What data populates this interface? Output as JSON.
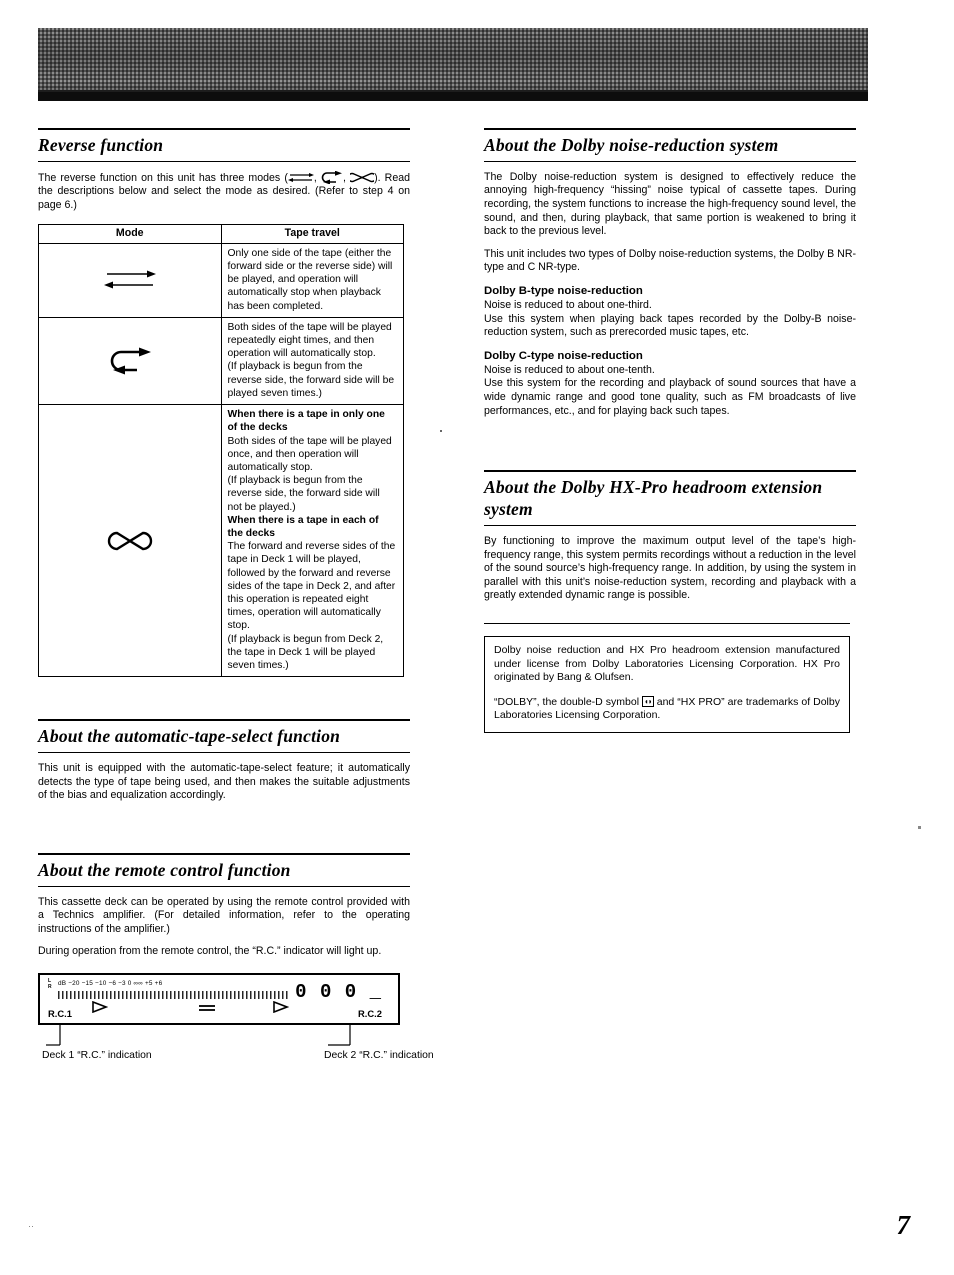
{
  "page": {
    "number": "7",
    "corner_mark": "··"
  },
  "left_column": {
    "reverse": {
      "title": "Reverse function",
      "intro_1": "The reverse function on this unit has three modes (",
      "intro_2": ", ",
      "intro_3": ", ",
      "intro_4": "). Read the descriptions below and select the mode as desired. (Refer to step 4 on page 6.)",
      "table": {
        "headers": [
          "Mode",
          "Tape travel"
        ],
        "rows": [
          {
            "icon": "single-direction-arrows-icon",
            "paragraphs": [
              {
                "bold": false,
                "text": "Only one side of the tape (either the forward side or the reverse side) will be played, and operation will automatically stop when playback has been completed."
              }
            ]
          },
          {
            "icon": "loop-arrow-icon",
            "paragraphs": [
              {
                "bold": false,
                "text": "Both sides of the tape will be played repeatedly eight times, and then operation will automatically stop."
              },
              {
                "bold": false,
                "text": "(If playback is begun from the reverse side, the forward side will be played seven times.)"
              }
            ]
          },
          {
            "icon": "double-loop-arrow-icon",
            "paragraphs": [
              {
                "bold": true,
                "text": "When there is a tape in only one of the decks"
              },
              {
                "bold": false,
                "text": "Both sides of the tape will be played once, and then operation will automatically stop."
              },
              {
                "bold": false,
                "text": "(If playback is begun from the reverse side, the forward side will not be played.)"
              },
              {
                "bold": true,
                "text": "When there is a tape in each of the decks"
              },
              {
                "bold": false,
                "text": "The forward and reverse sides of the tape in Deck 1 will be played, followed by the forward and reverse sides of the tape in Deck 2, and after this operation is repeated eight times, operation will automatically stop."
              },
              {
                "bold": false,
                "text": "(If playback is begun from Deck 2, the tape in Deck 1 will be played seven times.)"
              }
            ]
          }
        ]
      }
    },
    "auto_tape_select": {
      "title": "About the automatic-tape-select function",
      "body": "This unit is equipped with the automatic-tape-select feature; it automatically detects the type of tape being used, and then makes the suitable adjustments of the bias and equalization accordingly."
    },
    "remote_control": {
      "title": "About the remote control function",
      "body_1": "This cassette deck can be operated by using the remote control provided with a Technics amplifier. (For detailed information, refer to the operating instructions of the amplifier.)",
      "body_2": "During operation from the remote control, the “R.C.” indicator will light up.",
      "display": {
        "channel_left": "L",
        "channel_right": "R",
        "scale": "dB  −20    −15    −10     −6     −3      0     ∞∞     +5     +6",
        "digits": "0 0 0 _",
        "label_left": "R.C.1",
        "label_right": "R.C.2",
        "play_icon": "play-triangle-icon",
        "eq_icon": "double-bar-icon"
      },
      "callout_left": "Deck 1 “R.C.” indication",
      "callout_right": "Deck 2 “R.C.” indication"
    }
  },
  "right_column": {
    "dolby_nr": {
      "title": "About the Dolby noise-reduction system",
      "body_1": "The Dolby noise-reduction system is designed to effectively reduce the annoying high-frequency “hissing” noise typical of cassette tapes. During recording, the system functions to increase the high-frequency sound level, the sound, and then, during playback, that same portion is weakened to bring it back to the previous level.",
      "body_2": "This unit includes two types of Dolby noise-reduction systems, the Dolby B NR-type and C NR-type.",
      "sub_b_title": "Dolby B-type noise-reduction",
      "sub_b_body_1": "Noise is reduced to about one-third.",
      "sub_b_body_2": "Use this system when playing back tapes recorded by the Dolby-B noise-reduction system, such as prerecorded music tapes, etc.",
      "sub_c_title": "Dolby C-type noise-reduction",
      "sub_c_body_1": "Noise is reduced to about one-tenth.",
      "sub_c_body_2": "Use this system for the recording and playback of sound sources that have a wide dynamic range and good tone quality, such as FM broadcasts of live performances, etc., and for playing back such tapes."
    },
    "hx_pro": {
      "title": "About the Dolby HX-Pro headroom extension system",
      "body": "By functioning to improve the maximum output level of the tape’s high-frequency range, this system permits recordings without a reduction in the level of the sound source’s high-frequency range. In addition, by using the system in parallel with this unit’s noise-reduction system, recording and playback with a greatly extended dynamic range is possible."
    },
    "trademark_box": {
      "paragraph_1": "Dolby noise reduction and HX Pro headroom extension manufactured under license from Dolby Laboratories Licensing Corporation. HX Pro originated by Bang & Olufsen.",
      "paragraph_2_a": "“DOLBY”, the double-D symbol ",
      "paragraph_2_symbol": "◗◖",
      "paragraph_2_b": " and “HX PRO” are trademarks of Dolby Laboratories Licensing Corporation."
    }
  }
}
